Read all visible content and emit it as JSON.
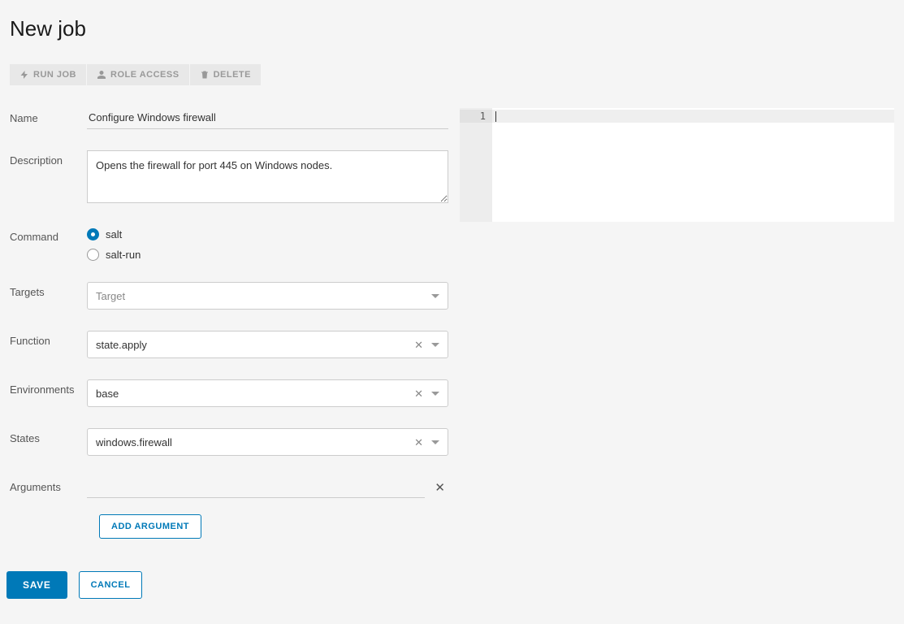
{
  "page": {
    "title": "New job"
  },
  "toolbar": {
    "run_job": "RUN JOB",
    "role_access": "ROLE ACCESS",
    "delete": "DELETE"
  },
  "form": {
    "labels": {
      "name": "Name",
      "description": "Description",
      "command": "Command",
      "targets": "Targets",
      "function": "Function",
      "environments": "Environments",
      "states": "States",
      "arguments": "Arguments"
    },
    "name": "Configure Windows firewall",
    "description": "Opens the firewall for port 445 on Windows nodes.",
    "command": {
      "options": [
        {
          "value": "salt",
          "label": "salt",
          "checked": true
        },
        {
          "value": "salt-run",
          "label": "salt-run",
          "checked": false
        }
      ]
    },
    "targets": {
      "placeholder": "Target",
      "value": ""
    },
    "function": {
      "value": "state.apply"
    },
    "environments": {
      "value": "base"
    },
    "states": {
      "value": "windows.firewall"
    },
    "arguments": [
      {
        "value": ""
      }
    ],
    "add_argument": "ADD ARGUMENT"
  },
  "actions": {
    "save": "SAVE",
    "cancel": "CANCEL"
  },
  "editor": {
    "lines": [
      "1"
    ]
  }
}
